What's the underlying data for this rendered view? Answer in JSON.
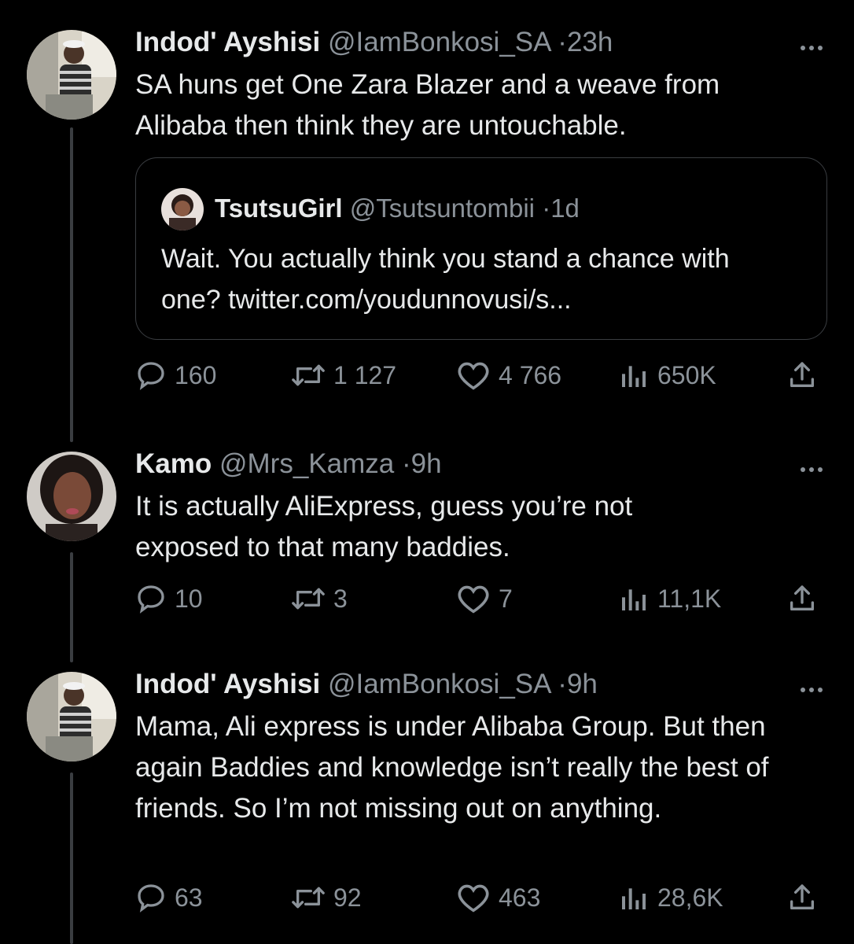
{
  "tweets": [
    {
      "name": "Indod' Ayshisi",
      "handle": "@IamBonkosi_SA",
      "time": "23h",
      "text": "SA huns get One Zara Blazer and a weave from Alibaba then think they are untouchable.",
      "quote": {
        "name": "TsutsuGirl",
        "handle": "@Tsutsuntombii",
        "time": "1d",
        "text": "Wait. You actually think you stand a chance with one? twitter.com/youdunnovusi/s..."
      },
      "stats": {
        "replies": "160",
        "retweets": "1 127",
        "likes": "4 766",
        "views": "650K"
      }
    },
    {
      "name": "Kamo",
      "handle": "@Mrs_Kamza",
      "time": "9h",
      "text": "It is actually AliExpress, guess you’re not exposed to that many baddies.",
      "stats": {
        "replies": "10",
        "retweets": "3",
        "likes": "7",
        "views": "11,1K"
      }
    },
    {
      "name": "Indod' Ayshisi",
      "handle": "@IamBonkosi_SA",
      "time": "9h",
      "text": "Mama, Ali express is under Alibaba Group. But then again Baddies and knowledge isn’t really the best of friends. So I’m not missing out on anything.",
      "stats": {
        "replies": "63",
        "retweets": "92",
        "likes": "463",
        "views": "28,6K"
      }
    }
  ],
  "separator": "·",
  "colors": {
    "background": "#000000",
    "text": "#e7e9ea",
    "muted": "#8b9299",
    "border": "#3a3d41"
  },
  "icons": [
    "more-icon",
    "reply-icon",
    "retweet-icon",
    "like-icon",
    "views-icon",
    "share-icon"
  ]
}
